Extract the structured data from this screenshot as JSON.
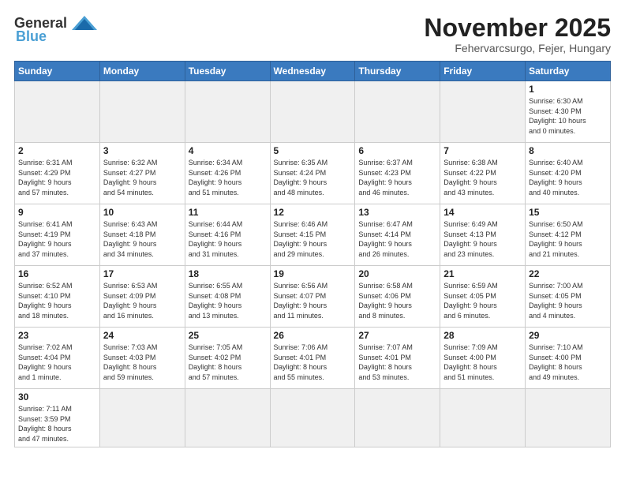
{
  "logo": {
    "general": "General",
    "blue": "Blue"
  },
  "title": "November 2025",
  "subtitle": "Fehervarcsurgo, Fejer, Hungary",
  "weekdays": [
    "Sunday",
    "Monday",
    "Tuesday",
    "Wednesday",
    "Thursday",
    "Friday",
    "Saturday"
  ],
  "weeks": [
    [
      {
        "day": "",
        "info": "",
        "empty": true
      },
      {
        "day": "",
        "info": "",
        "empty": true
      },
      {
        "day": "",
        "info": "",
        "empty": true
      },
      {
        "day": "",
        "info": "",
        "empty": true
      },
      {
        "day": "",
        "info": "",
        "empty": true
      },
      {
        "day": "",
        "info": "",
        "empty": true
      },
      {
        "day": "1",
        "info": "Sunrise: 6:30 AM\nSunset: 4:30 PM\nDaylight: 10 hours\nand 0 minutes.",
        "empty": false
      }
    ],
    [
      {
        "day": "2",
        "info": "Sunrise: 6:31 AM\nSunset: 4:29 PM\nDaylight: 9 hours\nand 57 minutes.",
        "empty": false
      },
      {
        "day": "3",
        "info": "Sunrise: 6:32 AM\nSunset: 4:27 PM\nDaylight: 9 hours\nand 54 minutes.",
        "empty": false
      },
      {
        "day": "4",
        "info": "Sunrise: 6:34 AM\nSunset: 4:26 PM\nDaylight: 9 hours\nand 51 minutes.",
        "empty": false
      },
      {
        "day": "5",
        "info": "Sunrise: 6:35 AM\nSunset: 4:24 PM\nDaylight: 9 hours\nand 48 minutes.",
        "empty": false
      },
      {
        "day": "6",
        "info": "Sunrise: 6:37 AM\nSunset: 4:23 PM\nDaylight: 9 hours\nand 46 minutes.",
        "empty": false
      },
      {
        "day": "7",
        "info": "Sunrise: 6:38 AM\nSunset: 4:22 PM\nDaylight: 9 hours\nand 43 minutes.",
        "empty": false
      },
      {
        "day": "8",
        "info": "Sunrise: 6:40 AM\nSunset: 4:20 PM\nDaylight: 9 hours\nand 40 minutes.",
        "empty": false
      }
    ],
    [
      {
        "day": "9",
        "info": "Sunrise: 6:41 AM\nSunset: 4:19 PM\nDaylight: 9 hours\nand 37 minutes.",
        "empty": false
      },
      {
        "day": "10",
        "info": "Sunrise: 6:43 AM\nSunset: 4:18 PM\nDaylight: 9 hours\nand 34 minutes.",
        "empty": false
      },
      {
        "day": "11",
        "info": "Sunrise: 6:44 AM\nSunset: 4:16 PM\nDaylight: 9 hours\nand 31 minutes.",
        "empty": false
      },
      {
        "day": "12",
        "info": "Sunrise: 6:46 AM\nSunset: 4:15 PM\nDaylight: 9 hours\nand 29 minutes.",
        "empty": false
      },
      {
        "day": "13",
        "info": "Sunrise: 6:47 AM\nSunset: 4:14 PM\nDaylight: 9 hours\nand 26 minutes.",
        "empty": false
      },
      {
        "day": "14",
        "info": "Sunrise: 6:49 AM\nSunset: 4:13 PM\nDaylight: 9 hours\nand 23 minutes.",
        "empty": false
      },
      {
        "day": "15",
        "info": "Sunrise: 6:50 AM\nSunset: 4:12 PM\nDaylight: 9 hours\nand 21 minutes.",
        "empty": false
      }
    ],
    [
      {
        "day": "16",
        "info": "Sunrise: 6:52 AM\nSunset: 4:10 PM\nDaylight: 9 hours\nand 18 minutes.",
        "empty": false
      },
      {
        "day": "17",
        "info": "Sunrise: 6:53 AM\nSunset: 4:09 PM\nDaylight: 9 hours\nand 16 minutes.",
        "empty": false
      },
      {
        "day": "18",
        "info": "Sunrise: 6:55 AM\nSunset: 4:08 PM\nDaylight: 9 hours\nand 13 minutes.",
        "empty": false
      },
      {
        "day": "19",
        "info": "Sunrise: 6:56 AM\nSunset: 4:07 PM\nDaylight: 9 hours\nand 11 minutes.",
        "empty": false
      },
      {
        "day": "20",
        "info": "Sunrise: 6:58 AM\nSunset: 4:06 PM\nDaylight: 9 hours\nand 8 minutes.",
        "empty": false
      },
      {
        "day": "21",
        "info": "Sunrise: 6:59 AM\nSunset: 4:05 PM\nDaylight: 9 hours\nand 6 minutes.",
        "empty": false
      },
      {
        "day": "22",
        "info": "Sunrise: 7:00 AM\nSunset: 4:05 PM\nDaylight: 9 hours\nand 4 minutes.",
        "empty": false
      }
    ],
    [
      {
        "day": "23",
        "info": "Sunrise: 7:02 AM\nSunset: 4:04 PM\nDaylight: 9 hours\nand 1 minute.",
        "empty": false
      },
      {
        "day": "24",
        "info": "Sunrise: 7:03 AM\nSunset: 4:03 PM\nDaylight: 8 hours\nand 59 minutes.",
        "empty": false
      },
      {
        "day": "25",
        "info": "Sunrise: 7:05 AM\nSunset: 4:02 PM\nDaylight: 8 hours\nand 57 minutes.",
        "empty": false
      },
      {
        "day": "26",
        "info": "Sunrise: 7:06 AM\nSunset: 4:01 PM\nDaylight: 8 hours\nand 55 minutes.",
        "empty": false
      },
      {
        "day": "27",
        "info": "Sunrise: 7:07 AM\nSunset: 4:01 PM\nDaylight: 8 hours\nand 53 minutes.",
        "empty": false
      },
      {
        "day": "28",
        "info": "Sunrise: 7:09 AM\nSunset: 4:00 PM\nDaylight: 8 hours\nand 51 minutes.",
        "empty": false
      },
      {
        "day": "29",
        "info": "Sunrise: 7:10 AM\nSunset: 4:00 PM\nDaylight: 8 hours\nand 49 minutes.",
        "empty": false
      }
    ],
    [
      {
        "day": "30",
        "info": "Sunrise: 7:11 AM\nSunset: 3:59 PM\nDaylight: 8 hours\nand 47 minutes.",
        "empty": false
      },
      {
        "day": "",
        "info": "",
        "empty": true
      },
      {
        "day": "",
        "info": "",
        "empty": true
      },
      {
        "day": "",
        "info": "",
        "empty": true
      },
      {
        "day": "",
        "info": "",
        "empty": true
      },
      {
        "day": "",
        "info": "",
        "empty": true
      },
      {
        "day": "",
        "info": "",
        "empty": true
      }
    ]
  ]
}
